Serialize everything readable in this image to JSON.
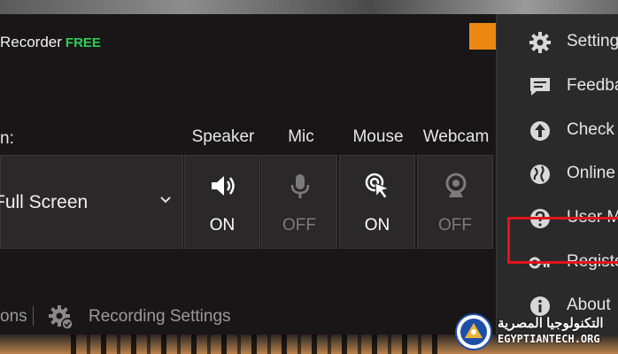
{
  "app": {
    "title": "Recorder",
    "edition": "FREE",
    "accent_color": "#EA8A12"
  },
  "recording_area": {
    "label": "n:",
    "selected": "Full Screen"
  },
  "columns": {
    "speaker": "Speaker",
    "mic": "Mic",
    "mouse": "Mouse",
    "webcam": "Webcam"
  },
  "toggles": {
    "speaker": {
      "state": "ON",
      "icon": "speaker-icon"
    },
    "mic": {
      "state": "OFF",
      "icon": "microphone-icon"
    },
    "mouse": {
      "state": "ON",
      "icon": "mouse-click-icon"
    },
    "webcam": {
      "state": "OFF",
      "icon": "webcam-icon"
    }
  },
  "footer": {
    "options_label": "ons",
    "recording_settings_label": "Recording Settings"
  },
  "menu": {
    "items": [
      {
        "label": "Setting",
        "icon": "gear-icon"
      },
      {
        "label": "Feedba",
        "icon": "feedback-icon"
      },
      {
        "label": "Check",
        "icon": "upload-icon"
      },
      {
        "label": "Online",
        "icon": "globe-icon"
      },
      {
        "label": "User M",
        "icon": "help-icon"
      },
      {
        "label": "Registe",
        "icon": "key-icon"
      },
      {
        "label": "About",
        "icon": "info-icon"
      }
    ],
    "highlight_color": "#E3141B"
  },
  "watermark": {
    "arabic": "التكنولوجيا المصرية",
    "english": "EGYPTIANTECH.ORG"
  }
}
